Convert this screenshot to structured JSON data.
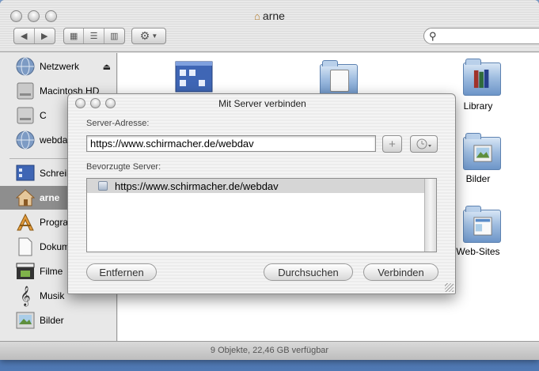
{
  "finder": {
    "title": "arne",
    "sidebar": [
      {
        "label": "Netzwerk",
        "icon": "globe-icon",
        "eject": true
      },
      {
        "label": "Macintosh HD",
        "icon": "hard-drive-icon"
      },
      {
        "label": "C",
        "icon": "disk-icon"
      },
      {
        "label": "webdav",
        "icon": "globe-icon"
      },
      {
        "label": "Schreibtisch",
        "icon": "desktop-icon"
      },
      {
        "label": "arne",
        "icon": "home-icon",
        "selected": true
      },
      {
        "label": "Programme",
        "icon": "applications-icon"
      },
      {
        "label": "Dokumente",
        "icon": "documents-icon"
      },
      {
        "label": "Filme",
        "icon": "movies-icon"
      },
      {
        "label": "Musik",
        "icon": "music-icon"
      },
      {
        "label": "Bilder",
        "icon": "pictures-icon"
      }
    ],
    "items": [
      {
        "label": "Library"
      },
      {
        "label": "Bilder"
      },
      {
        "label": "Web-Sites"
      }
    ],
    "status": "9 Objekte, 22,46 GB verfügbar"
  },
  "dialog": {
    "title": "Mit Server verbinden",
    "server_label": "Server-Adresse:",
    "server_value": "https://www.schirmacher.de/webdav",
    "add_symbol": "+",
    "favorites_label": "Bevorzugte Server:",
    "favorites": [
      {
        "address": "https://www.schirmacher.de/webdav"
      }
    ],
    "buttons": {
      "remove": "Entfernen",
      "browse": "Durchsuchen",
      "connect": "Verbinden"
    }
  },
  "colors": {
    "selection": "#8e8e8e",
    "folder_blue": "#9fbde0",
    "desktop": "#4f78b3"
  }
}
